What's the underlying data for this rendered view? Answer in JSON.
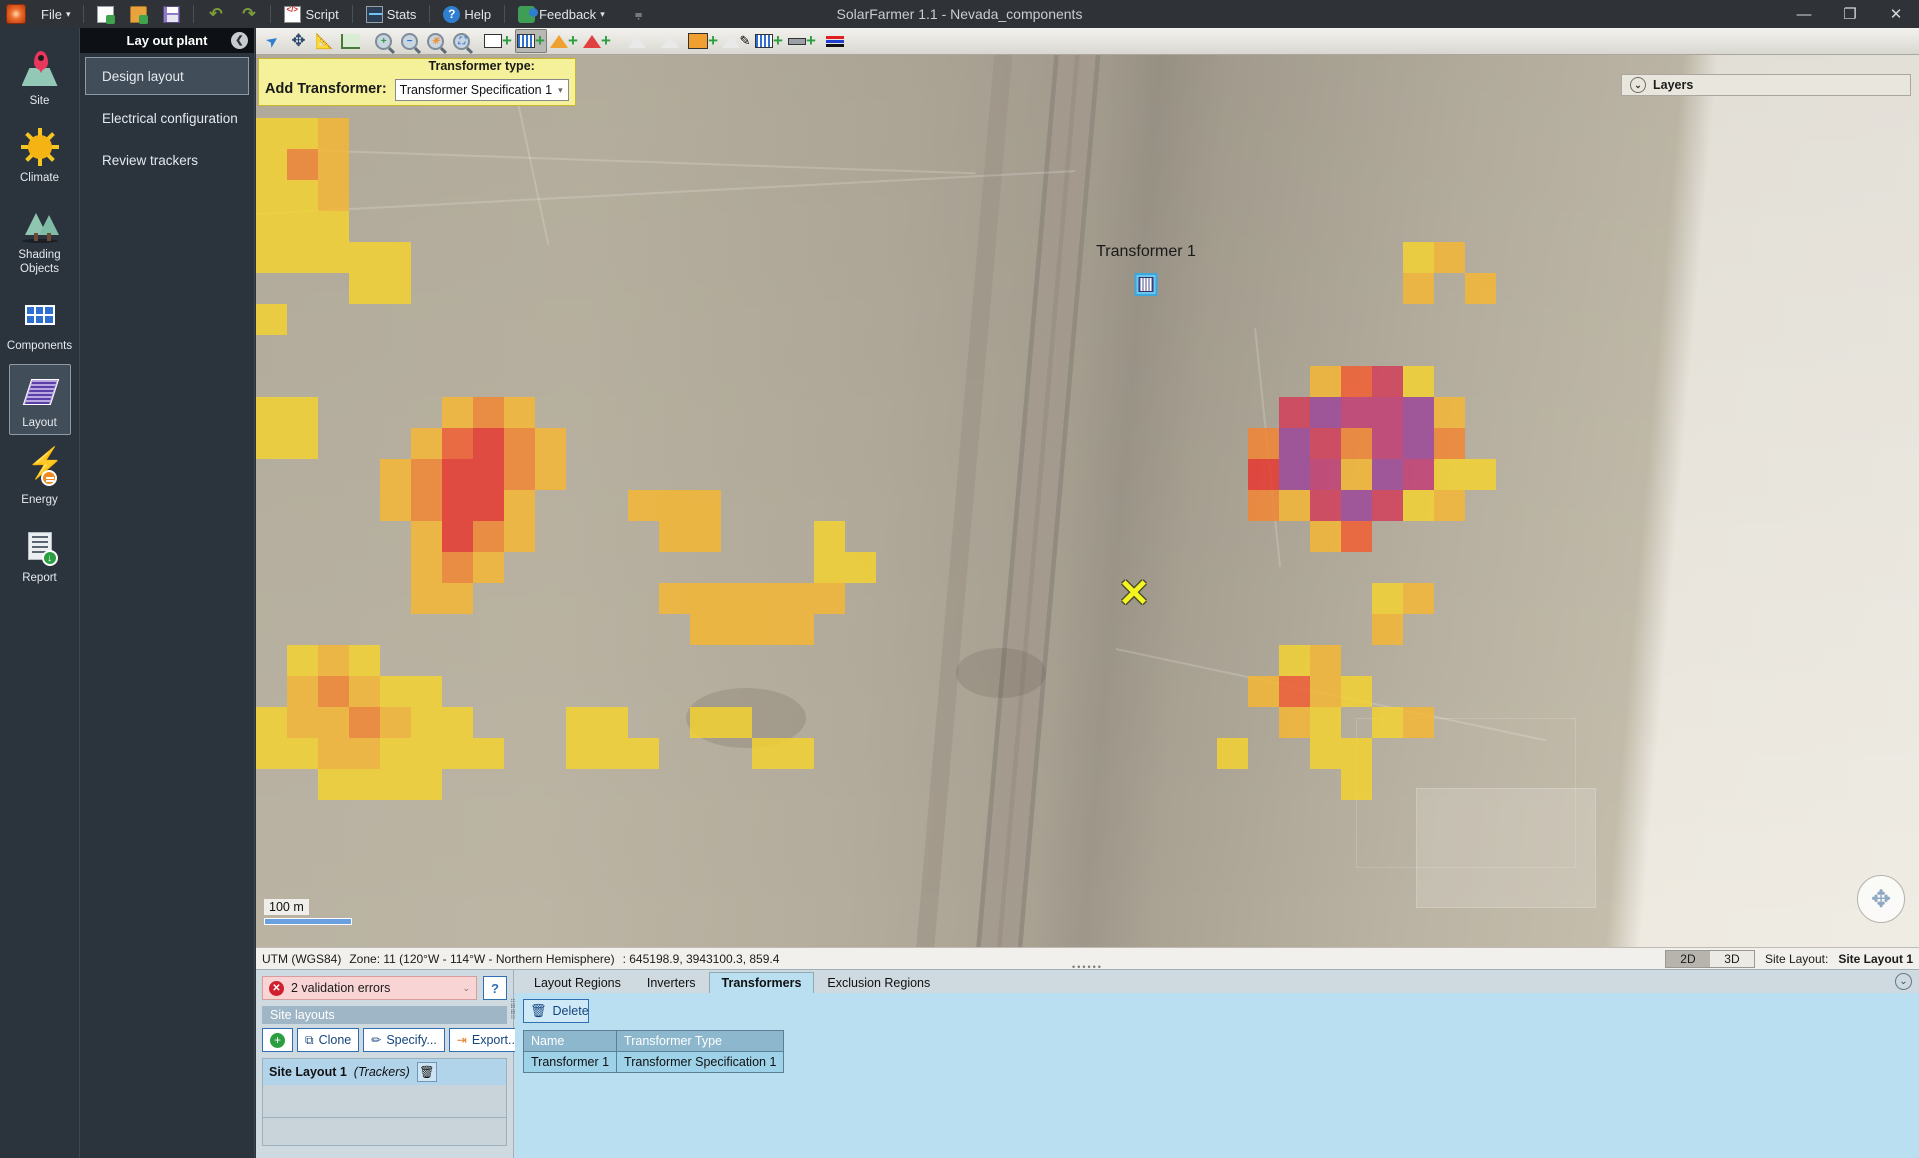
{
  "window": {
    "title": "SolarFarmer 1.1 - Nevada_components",
    "minimize": "—",
    "maximize": "❐",
    "close": "✕"
  },
  "menubar": {
    "logo": "app-logo",
    "items": [
      {
        "label": "File",
        "caret": "▾",
        "icon": "app-menu-icon"
      },
      {
        "label": "",
        "icon": "new-file-icon"
      },
      {
        "label": "",
        "icon": "open-folder-icon"
      },
      {
        "label": "",
        "icon": "save-disk-icon"
      },
      {
        "label": "",
        "icon": "undo-icon"
      },
      {
        "label": "",
        "icon": "redo-icon"
      },
      {
        "label": "Script",
        "icon": "script-icon"
      },
      {
        "label": "Stats",
        "icon": "stats-icon"
      },
      {
        "label": "Help",
        "icon": "help-icon"
      },
      {
        "label": "Feedback",
        "caret": "▾",
        "icon": "feedback-icon"
      },
      {
        "label": "",
        "icon": "overflow-icon"
      }
    ],
    "overflow": "⩦"
  },
  "rail": {
    "items": [
      {
        "label": "Site",
        "icon": "site-pin-icon",
        "active": false
      },
      {
        "label": "Climate",
        "icon": "sun-icon",
        "active": false
      },
      {
        "label": "Shading Objects",
        "icon": "trees-icon",
        "active": false
      },
      {
        "label": "Components",
        "icon": "panel-grid-icon",
        "active": false
      },
      {
        "label": "Layout",
        "icon": "layout-array-icon",
        "active": true
      },
      {
        "label": "Energy",
        "icon": "lightning-bolt-icon",
        "active": false
      },
      {
        "label": "Report",
        "icon": "report-doc-icon",
        "active": false
      }
    ]
  },
  "navpanel": {
    "title": "Lay out plant",
    "collapse_glyph": "❮",
    "items": [
      {
        "label": "Design layout",
        "active": true
      },
      {
        "label": "Electrical configuration",
        "active": false
      },
      {
        "label": "Review trackers",
        "active": false
      }
    ]
  },
  "maptoolbar": {
    "buttons": [
      {
        "name": "select-tool",
        "glyph": "arrow",
        "active": false
      },
      {
        "name": "pan-tool",
        "glyph": "move",
        "active": false
      },
      {
        "name": "measure-tool",
        "glyph": "ruler",
        "active": false
      },
      {
        "name": "profile-tool",
        "glyph": "chart",
        "active": false
      },
      {
        "name": "zoom-in-tool",
        "glyph": "zoom-in",
        "active": false
      },
      {
        "name": "zoom-out-tool",
        "glyph": "zoom-out",
        "active": false
      },
      {
        "name": "zoom-extents-tool",
        "glyph": "zoom-extents",
        "active": false
      },
      {
        "name": "zoom-selection-tool",
        "glyph": "zoom-fit",
        "active": false
      },
      {
        "name": "add-layout-region-tool",
        "glyph": "add-region",
        "active": false
      },
      {
        "name": "add-transformer-tool",
        "glyph": "add-transformer",
        "active": true
      },
      {
        "name": "add-inverter-tool",
        "glyph": "add-inverter",
        "active": false
      },
      {
        "name": "add-exclusion-tool",
        "glyph": "add-exclusion",
        "active": false
      },
      {
        "name": "add-keepout-tool",
        "glyph": "add-keepout",
        "active": false
      },
      {
        "name": "edit-region-tool",
        "glyph": "edit-region",
        "active": false
      },
      {
        "name": "fill-region-tool",
        "glyph": "fill-region",
        "active": false
      },
      {
        "name": "draw-region-tool",
        "glyph": "draw-region",
        "active": false
      },
      {
        "name": "add-array-tool",
        "glyph": "add-array",
        "active": false
      },
      {
        "name": "add-cable-tool",
        "glyph": "add-cable",
        "active": false
      },
      {
        "name": "edit-cable-tool",
        "glyph": "edit-cable",
        "active": false
      }
    ]
  },
  "addbar": {
    "label": "Add Transformer:",
    "field_caption": "Transformer type:",
    "selected_type": "Transformer Specification 1",
    "caret": "▾"
  },
  "layers": {
    "label": "Layers",
    "chevron": "⌄"
  },
  "map": {
    "transformer_label": "Transformer 1",
    "transformer_icon": "transformer-icon",
    "cursor_marker": "✕",
    "scale_label": "100 m",
    "compass_icon": "pan-compass-icon"
  },
  "statusbar": {
    "projection": "UTM (WGS84)",
    "zone": "Zone: 11 (120°W - 114°W - Northern Hemisphere)",
    "coords": ": 645198.9, 3943100.3, 859.4",
    "view_2d": "2D",
    "view_3d": "3D",
    "view_active": "2D",
    "site_layout_label": "Site Layout:",
    "site_layout_value": "Site Layout 1"
  },
  "dock": {
    "left": {
      "validation_text": "2 validation errors",
      "validation_icon": "error-icon",
      "validation_caret": "⌄",
      "help_label": "?",
      "section_title": "Site layouts",
      "buttons": [
        {
          "label": "",
          "icon": "add-icon",
          "name": "add-site-layout-button"
        },
        {
          "label": "Clone",
          "icon": "clone-icon",
          "name": "clone-button"
        },
        {
          "label": "Specify...",
          "icon": "pencil-icon",
          "name": "specify-button"
        },
        {
          "label": "Export...",
          "icon": "export-icon",
          "name": "export-button"
        }
      ],
      "layout_row": {
        "name": "Site Layout 1",
        "kind": "(Trackers)",
        "delete_icon": "trash-icon"
      }
    },
    "right": {
      "tabs": [
        {
          "label": "Layout Regions",
          "active": false
        },
        {
          "label": "Inverters",
          "active": false
        },
        {
          "label": "Transformers",
          "active": true
        },
        {
          "label": "Exclusion Regions",
          "active": false
        }
      ],
      "delete_button": {
        "label": "Delete",
        "icon": "trash-icon"
      },
      "table": {
        "columns": [
          "Name",
          "Transformer Type"
        ],
        "rows": [
          [
            "Transformer 1",
            "Transformer Specification 1"
          ]
        ]
      },
      "collapse_glyph": "⌄"
    }
  },
  "heatmap": {
    "colors": {
      "yellow": "#f5d32e",
      "amber": "#f7b731",
      "orange": "#f4842f",
      "orange_red": "#f45c30",
      "red": "#e8332c",
      "crimson": "#d33b58",
      "magenta": "#c23b73",
      "purple": "#9b4499"
    }
  }
}
